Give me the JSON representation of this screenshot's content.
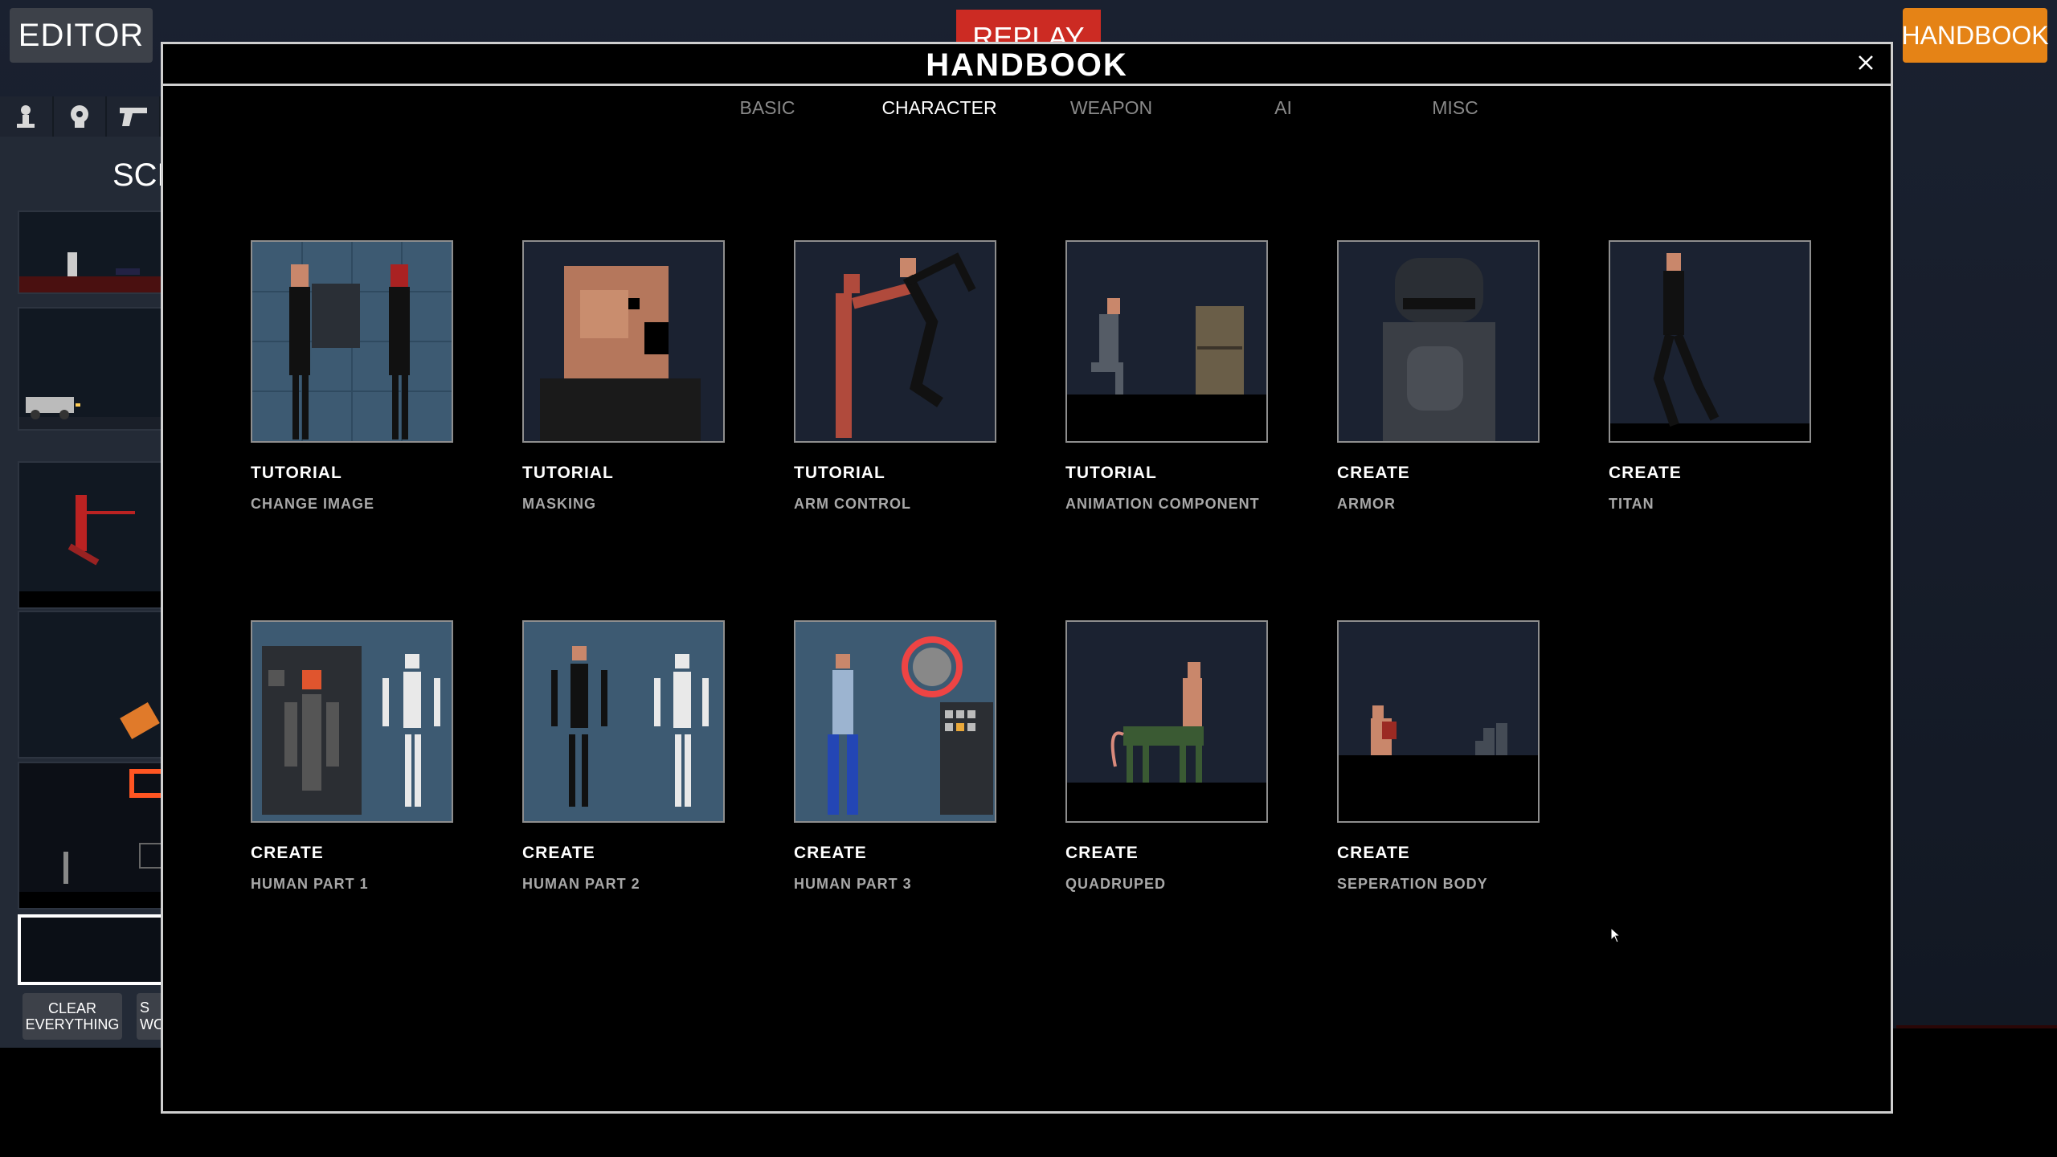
{
  "topbar": {
    "editor_label": "EDITOR",
    "replay_label": "REPLAY",
    "handbook_label": "HANDBOOK"
  },
  "left_panel": {
    "tab_icons": [
      "person-icon",
      "brain-icon",
      "gun-icon"
    ],
    "scenes_title": "SCE",
    "clear_label_line1": "CLEAR",
    "clear_label_line2": "EVERYTHING",
    "save_label_line1": "S",
    "save_label_line2": "WO"
  },
  "modal": {
    "title": "HANDBOOK",
    "close_icon": "close-icon",
    "tabs": [
      "BASIC",
      "CHARACTER",
      "WEAPON",
      "AI",
      "MISC"
    ],
    "active_tab": "CHARACTER",
    "cards": [
      {
        "kind": "TUTORIAL",
        "name": "CHANGE IMAGE"
      },
      {
        "kind": "TUTORIAL",
        "name": "MASKING"
      },
      {
        "kind": "TUTORIAL",
        "name": "ARM CONTROL"
      },
      {
        "kind": "TUTORIAL",
        "name": "ANIMATION COMPONENT"
      },
      {
        "kind": "CREATE",
        "name": "ARMOR"
      },
      {
        "kind": "CREATE",
        "name": "TITAN"
      },
      {
        "kind": "CREATE",
        "name": "HUMAN PART 1"
      },
      {
        "kind": "CREATE",
        "name": "HUMAN PART 2"
      },
      {
        "kind": "CREATE",
        "name": "HUMAN PART 3"
      },
      {
        "kind": "CREATE",
        "name": "QUADRUPED"
      },
      {
        "kind": "CREATE",
        "name": "SEPERATION BODY"
      }
    ]
  },
  "colors": {
    "accent_handbook": "#e58316",
    "replay_red": "#cc2b23",
    "modal_border": "#cfcfcf",
    "card_bg_blue": "#3d5a72",
    "card_bg_dark": "#1b2231"
  }
}
